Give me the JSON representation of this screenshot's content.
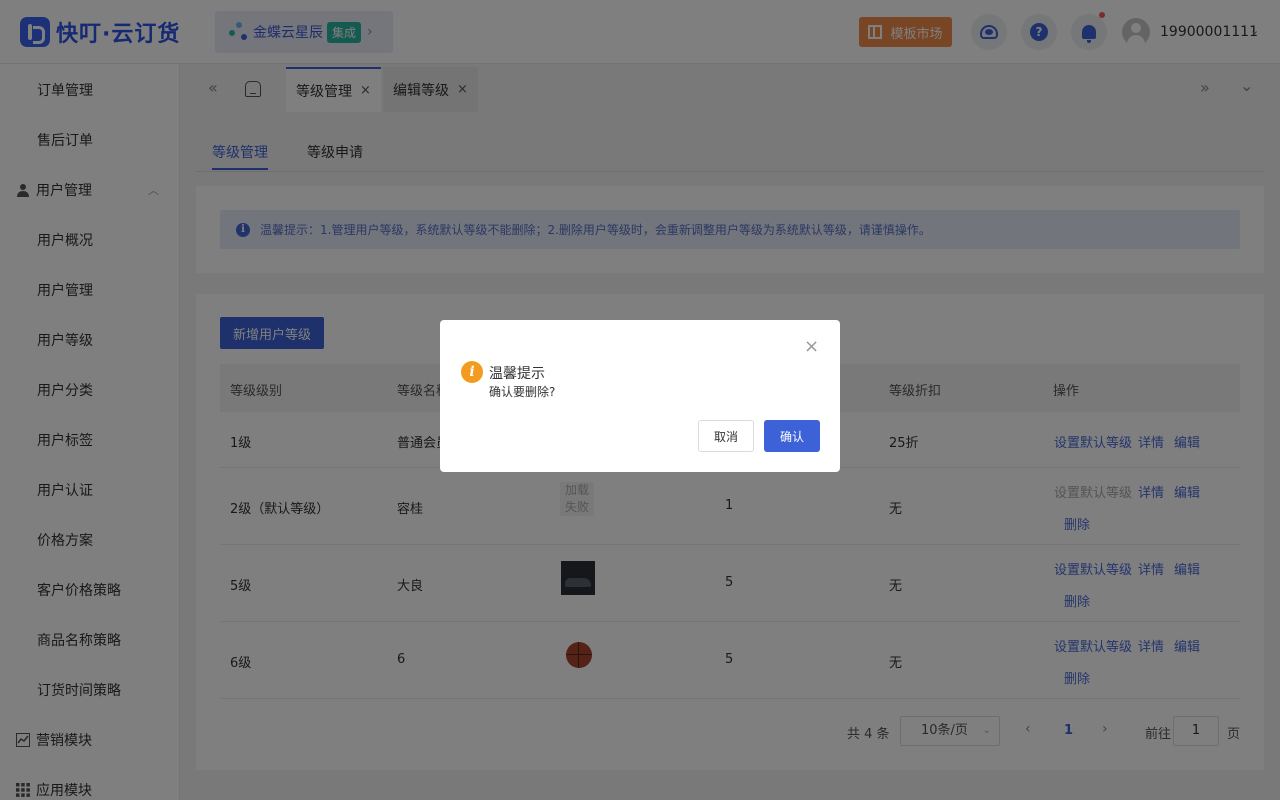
{
  "header": {
    "logo_text": "快叮·云订货",
    "org_name": "金蝶云星辰",
    "org_badge": "集成",
    "market_label": "模板市场",
    "help_glyph": "?",
    "user_name": "19900001111",
    "colors": {
      "accent": "#3d62d8",
      "market": "#f08a4b",
      "badge": "#2bb5a3"
    }
  },
  "sidebar": {
    "items": [
      "订单管理",
      "售后订单"
    ],
    "user_group": "用户管理",
    "user_items": [
      "用户概况",
      "用户管理",
      "用户等级",
      "用户分类",
      "用户标签",
      "用户认证",
      "价格方案",
      "客户价格策略",
      "商品名称策略",
      "订货时间策略"
    ],
    "marketing_group": "营销模块",
    "app_group": "应用模块"
  },
  "tabs": [
    {
      "label": "等级管理",
      "active": true
    },
    {
      "label": "编辑等级",
      "active": false
    }
  ],
  "subtabs": [
    "等级管理",
    "等级申请"
  ],
  "notice": "温馨提示：1.管理用户等级，系统默认等级不能删除；2.删除用户等级时，会重新调整用户等级为系统默认等级，请谨慎操作。",
  "add_button": "新增用户等级",
  "table": {
    "headers": [
      "等级级别",
      "等级名称",
      "",
      "",
      "等级折扣",
      "操作"
    ],
    "rows": [
      {
        "level": "1级",
        "name": "普通会员",
        "discount": "25折",
        "ops": [
          "设置默认等级",
          "详情",
          "编辑"
        ]
      },
      {
        "level": "2级（默认等级）",
        "name": "容桂",
        "image_text": "加载失败",
        "num": "1",
        "discount": "无",
        "ops": [
          "设置默认等级",
          "详情",
          "编辑",
          "删除"
        ]
      },
      {
        "level": "5级",
        "name": "大良",
        "num": "5",
        "discount": "无",
        "ops": [
          "设置默认等级",
          "详情",
          "编辑",
          "删除"
        ]
      },
      {
        "level": "6级",
        "name": "6",
        "num": "5",
        "discount": "无",
        "ops": [
          "设置默认等级",
          "详情",
          "编辑",
          "删除"
        ]
      }
    ]
  },
  "pagination": {
    "total": "共 4 条",
    "page_size": "10条/页",
    "current": "1",
    "goto_label": "前往",
    "goto_value": "1",
    "page_unit": "页"
  },
  "dialog": {
    "title": "温馨提示",
    "message": "确认要删除?",
    "cancel": "取消",
    "confirm": "确认",
    "close_glyph": "×",
    "warn_glyph": "i"
  }
}
